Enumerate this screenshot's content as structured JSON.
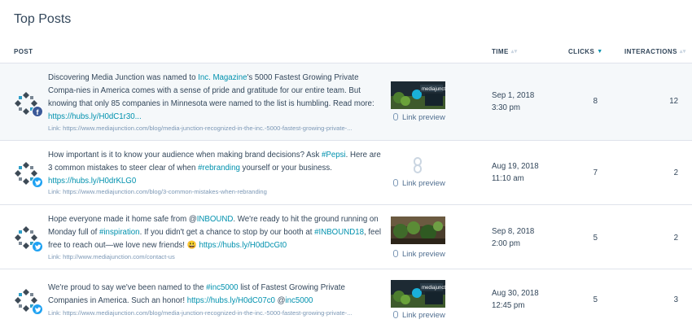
{
  "page_title": "Top Posts",
  "columns": {
    "post": "POST",
    "time": "TIME",
    "clicks": "CLICKS",
    "interactions": "INTERACTIONS"
  },
  "link_preview_label": "Link preview",
  "colors": {
    "accent": "#0091ae",
    "facebook": "#3b5998",
    "twitter": "#1da1f2",
    "row_highlight": "#f5f8fa"
  },
  "posts": [
    {
      "network": "facebook",
      "msg": {
        "t1": "Discovering Media Junction was named to ",
        "l1": "Inc. Magazine",
        "t2": "'s 5000 Fastest Growing Private Compa-nies in America comes with a sense of pride and gratitude for our entire team. But knowing that only 85 companies in Minnesota were named to the list is humbling. Read more: ",
        "l2": "https://hubs.ly/H0dC1r30...",
        "t3": ""
      },
      "link": "Link: https://www.mediajunction.com/blog/media-junction-recognized-in-the-inc.-5000-fastest-growing-private-...",
      "has_thumbnail": true,
      "date": "Sep 1, 2018",
      "time": "3:30 pm",
      "clicks": "8",
      "interactions": "12"
    },
    {
      "network": "twitter",
      "msg": {
        "t1": "How important is it to know your audience when making brand decisions? Ask ",
        "l1": "#Pepsi",
        "t2": ". Here are 3 common mistakes to steer clear of when ",
        "l2": "#rebranding",
        "t3": " yourself or your business. ",
        "l3": "https://hubs.ly/H0drKLG0"
      },
      "link": "Link: https://www.mediajunction.com/blog/3-common-mistakes-when-rebranding",
      "has_thumbnail": false,
      "date": "Aug 19, 2018",
      "time": "11:10 am",
      "clicks": "7",
      "interactions": "2"
    },
    {
      "network": "twitter",
      "msg": {
        "t1": "Hope everyone made it home safe from @",
        "l1": "INBOUND",
        "t2": ". We're ready to hit the ground running on Monday full of ",
        "l2": "#inspiration",
        "t3": ". If you didn't get a chance to stop by our booth at ",
        "l3": "#INBOUND18",
        "t4": ", feel free to reach out—we love new friends! 😃 ",
        "l4": "https://hubs.ly/H0dDcGt0"
      },
      "link": "Link: http://www.mediajunction.com/contact-us",
      "has_thumbnail": true,
      "date": "Sep 8, 2018",
      "time": "2:00 pm",
      "clicks": "5",
      "interactions": "2"
    },
    {
      "network": "twitter",
      "msg": {
        "t1": "We're proud to say we've been named to the ",
        "l1": "#inc5000",
        "t2": " list of Fastest Growing Private Companies in America. Such an honor! ",
        "l2": "https://hubs.ly/H0dC07c0",
        "t3": " @",
        "l3": "inc5000"
      },
      "link": "Link: https://www.mediajunction.com/blog/media-junction-recognized-in-the-inc.-5000-fastest-growing-private-...",
      "has_thumbnail": true,
      "date": "Aug 30, 2018",
      "time": "12:45 pm",
      "clicks": "5",
      "interactions": "3"
    }
  ]
}
